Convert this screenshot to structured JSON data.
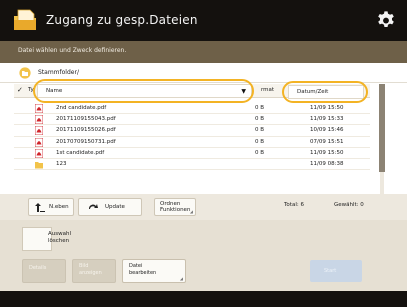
{
  "header": {
    "title": "Zugang zu gesp.Dateien",
    "instruction": "Datei wählen und Zweck definieren.",
    "icons": {
      "app": "file-share-icon",
      "settings": "gear-icon"
    }
  },
  "location": {
    "label": "Stammfolder/",
    "icon": "folder-location-icon"
  },
  "columns": {
    "check": "✓",
    "type": "Ty",
    "name": "Name",
    "size": "rmat",
    "date": "Datum/Zeit"
  },
  "files": [
    {
      "icon": "pdf-file-icon",
      "name": "2nd candidate.pdf",
      "size": "0 B",
      "date": "11/09 15:50"
    },
    {
      "icon": "pdf-file-icon",
      "name": "20171109155043.pdf",
      "size": "0 B",
      "date": "11/09 15:33"
    },
    {
      "icon": "pdf-file-icon",
      "name": "20171109155026.pdf",
      "size": "0 B",
      "date": "10/09 15:46"
    },
    {
      "icon": "pdf-file-icon",
      "name": "20170709150731.pdf",
      "size": "0 B",
      "date": "07/09 15:51"
    },
    {
      "icon": "pdf-file-icon",
      "name": "1st candidate.pdf",
      "size": "0 B",
      "date": "11/09 15:50"
    },
    {
      "icon": "folder-icon",
      "name": "123",
      "size": "",
      "date": "11/09 08:38"
    }
  ],
  "toolbar": {
    "up_label": "N.eben",
    "update_label": "Update",
    "folder_functions_label": "Ordnen\nFunktionen",
    "total_label": "Total: 6",
    "selected_label": "Gewählt: 0"
  },
  "panel": {
    "select_all_label": "Auswahl\nlöschen",
    "details_label": "Details",
    "display_label": "Bild\nanzeigen",
    "edit_label": "Datei\nbearbeiten",
    "start_label": "Start"
  },
  "colors": {
    "titlebar": "#14110e",
    "instruction_bar": "#6e6048",
    "highlight": "#f3b324",
    "pdf_red": "#d0242a",
    "folder_yellow": "#f2c34a"
  }
}
